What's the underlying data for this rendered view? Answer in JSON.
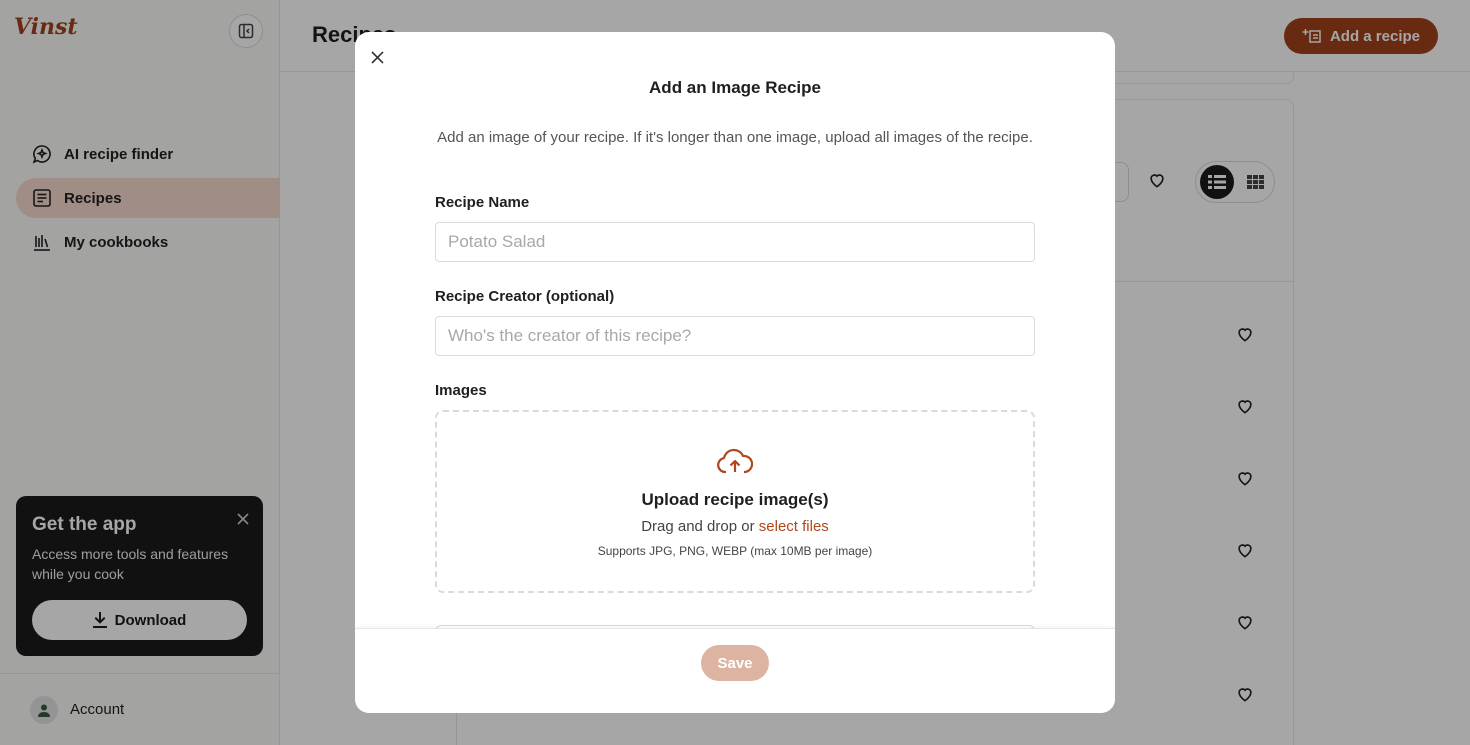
{
  "app": {
    "logo": "Vinst",
    "page_title": "Recipes",
    "add_recipe_label": "Add a recipe"
  },
  "sidebar": {
    "items": [
      {
        "label": "AI recipe finder",
        "icon": "chat-sparkle-icon",
        "active": false
      },
      {
        "label": "Recipes",
        "icon": "recipe-book-icon",
        "active": true
      },
      {
        "label": "My cookbooks",
        "icon": "bookshelf-icon",
        "active": false
      }
    ],
    "promo": {
      "title": "Get the app",
      "text": "Access more tools and features while you cook",
      "button": "Download"
    },
    "account_label": "Account"
  },
  "modal": {
    "title": "Add an Image Recipe",
    "description": "Add an image of your recipe. If it's longer than one image, upload all images of the recipe.",
    "recipe_name": {
      "label": "Recipe Name",
      "placeholder": "Potato Salad",
      "value": ""
    },
    "recipe_creator": {
      "label": "Recipe Creator (optional)",
      "placeholder": "Who's the creator of this recipe?",
      "value": ""
    },
    "images": {
      "label": "Images",
      "upload_title": "Upload recipe image(s)",
      "drag_text": "Drag and drop or",
      "select_link": "select files",
      "supports": "Supports JPG, PNG, WEBP (max 10MB per image)"
    },
    "save_label": "Save"
  },
  "colors": {
    "brand": "#a0421d",
    "active_nav": "#f6d9cc",
    "save_disabled": "#ddb4a2"
  }
}
